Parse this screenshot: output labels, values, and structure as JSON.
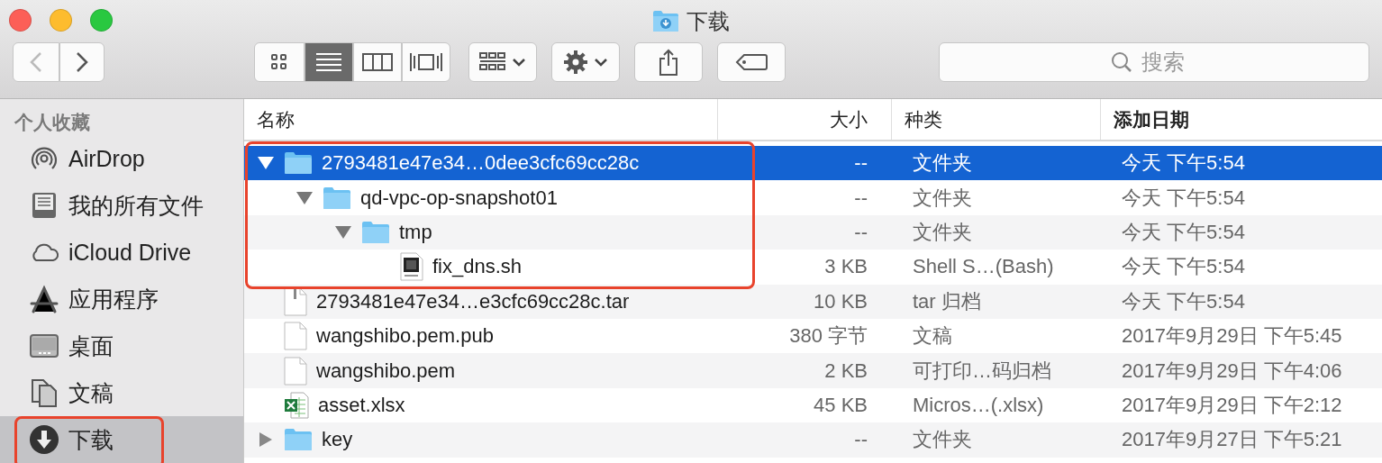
{
  "window": {
    "title": "下载"
  },
  "toolbar": {
    "views": [
      {
        "kind": "icons",
        "selected": false
      },
      {
        "kind": "list",
        "selected": true
      },
      {
        "kind": "columns",
        "selected": false
      },
      {
        "kind": "cover",
        "selected": false
      }
    ],
    "search": {
      "placeholder": "搜索"
    }
  },
  "sidebar": {
    "heading": "个人收藏",
    "items": [
      {
        "label": "AirDrop",
        "kind": "airdrop",
        "selected": false,
        "annotated": false
      },
      {
        "label": "我的所有文件",
        "kind": "allfiles",
        "selected": false,
        "annotated": false
      },
      {
        "label": "iCloud Drive",
        "kind": "cloud",
        "selected": false,
        "annotated": false
      },
      {
        "label": "应用程序",
        "kind": "apps",
        "selected": false,
        "annotated": false
      },
      {
        "label": "桌面",
        "kind": "desktop",
        "selected": false,
        "annotated": false
      },
      {
        "label": "文稿",
        "kind": "documents",
        "selected": false,
        "annotated": false
      },
      {
        "label": "下载",
        "kind": "downloads",
        "selected": true,
        "annotated": true
      }
    ]
  },
  "table": {
    "columns": [
      {
        "label": "名称",
        "sorted": false
      },
      {
        "label": "大小",
        "sorted": false
      },
      {
        "label": "种类",
        "sorted": false
      },
      {
        "label": "添加日期",
        "sorted": true
      }
    ],
    "rows": [
      {
        "kind": "folder",
        "name": "2793481e47e34…0dee3cfc69cc28c",
        "size": "--",
        "type": "文件夹",
        "date": "今天 下午5:54",
        "selected": true,
        "expanded": true,
        "annotated": true,
        "children": [
          {
            "kind": "folder",
            "name": "qd-vpc-op-snapshot01",
            "size": "--",
            "type": "文件夹",
            "date": "今天 下午5:54",
            "selected": false,
            "expanded": true,
            "children": [
              {
                "kind": "folder",
                "name": "tmp",
                "size": "--",
                "type": "文件夹",
                "date": "今天 下午5:54",
                "selected": false,
                "expanded": true,
                "children": [
                  {
                    "kind": "shell",
                    "name": "fix_dns.sh",
                    "size": "3 KB",
                    "type": "Shell S…(Bash)",
                    "date": "今天 下午5:54",
                    "selected": false
                  }
                ]
              }
            ]
          }
        ]
      },
      {
        "kind": "archive",
        "name": "2793481e47e34…e3cfc69cc28c.tar",
        "size": "10 KB",
        "type": "tar 归档",
        "date": "今天 下午5:54",
        "selected": false,
        "annotated": false
      },
      {
        "kind": "document",
        "name": "wangshibo.pem.pub",
        "size": "380 字节",
        "type": "文稿",
        "date": "2017年9月29日 下午5:45",
        "selected": false,
        "annotated": false
      },
      {
        "kind": "document",
        "name": "wangshibo.pem",
        "size": "2 KB",
        "type": "可打印…码归档",
        "date": "2017年9月29日 下午4:06",
        "selected": false,
        "annotated": false
      },
      {
        "kind": "spreadsheet",
        "name": "asset.xlsx",
        "size": "45 KB",
        "type": "Micros…(.xlsx)",
        "date": "2017年9月29日 下午2:12",
        "selected": false,
        "annotated": false
      },
      {
        "kind": "folder",
        "name": "key",
        "size": "--",
        "type": "文件夹",
        "date": "2017年9月27日 下午5:21",
        "selected": false,
        "expanded": false,
        "annotated": false
      }
    ]
  }
}
